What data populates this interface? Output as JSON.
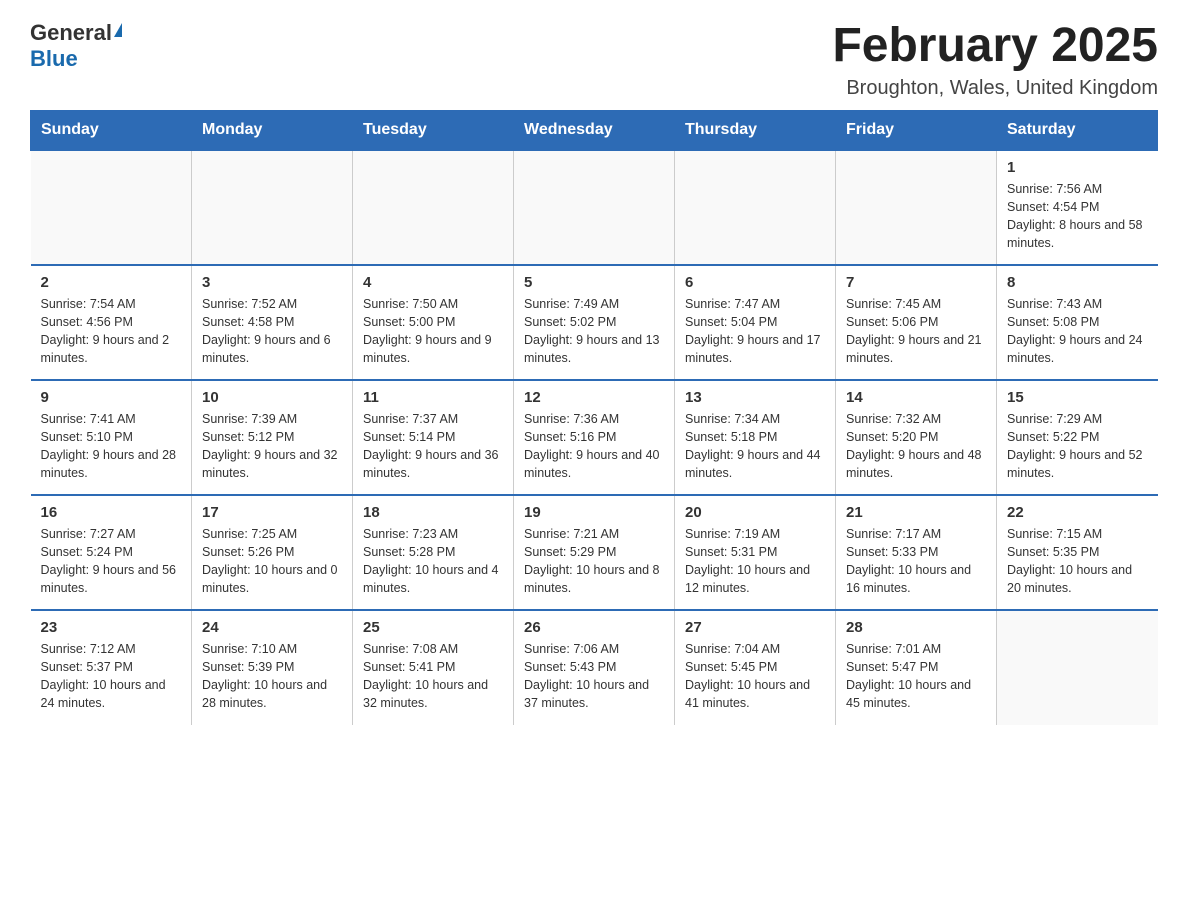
{
  "logo": {
    "general": "General",
    "blue": "Blue"
  },
  "title": "February 2025",
  "location": "Broughton, Wales, United Kingdom",
  "weekdays": [
    "Sunday",
    "Monday",
    "Tuesday",
    "Wednesday",
    "Thursday",
    "Friday",
    "Saturday"
  ],
  "weeks": [
    [
      {
        "day": "",
        "info": ""
      },
      {
        "day": "",
        "info": ""
      },
      {
        "day": "",
        "info": ""
      },
      {
        "day": "",
        "info": ""
      },
      {
        "day": "",
        "info": ""
      },
      {
        "day": "",
        "info": ""
      },
      {
        "day": "1",
        "info": "Sunrise: 7:56 AM\nSunset: 4:54 PM\nDaylight: 8 hours and 58 minutes."
      }
    ],
    [
      {
        "day": "2",
        "info": "Sunrise: 7:54 AM\nSunset: 4:56 PM\nDaylight: 9 hours and 2 minutes."
      },
      {
        "day": "3",
        "info": "Sunrise: 7:52 AM\nSunset: 4:58 PM\nDaylight: 9 hours and 6 minutes."
      },
      {
        "day": "4",
        "info": "Sunrise: 7:50 AM\nSunset: 5:00 PM\nDaylight: 9 hours and 9 minutes."
      },
      {
        "day": "5",
        "info": "Sunrise: 7:49 AM\nSunset: 5:02 PM\nDaylight: 9 hours and 13 minutes."
      },
      {
        "day": "6",
        "info": "Sunrise: 7:47 AM\nSunset: 5:04 PM\nDaylight: 9 hours and 17 minutes."
      },
      {
        "day": "7",
        "info": "Sunrise: 7:45 AM\nSunset: 5:06 PM\nDaylight: 9 hours and 21 minutes."
      },
      {
        "day": "8",
        "info": "Sunrise: 7:43 AM\nSunset: 5:08 PM\nDaylight: 9 hours and 24 minutes."
      }
    ],
    [
      {
        "day": "9",
        "info": "Sunrise: 7:41 AM\nSunset: 5:10 PM\nDaylight: 9 hours and 28 minutes."
      },
      {
        "day": "10",
        "info": "Sunrise: 7:39 AM\nSunset: 5:12 PM\nDaylight: 9 hours and 32 minutes."
      },
      {
        "day": "11",
        "info": "Sunrise: 7:37 AM\nSunset: 5:14 PM\nDaylight: 9 hours and 36 minutes."
      },
      {
        "day": "12",
        "info": "Sunrise: 7:36 AM\nSunset: 5:16 PM\nDaylight: 9 hours and 40 minutes."
      },
      {
        "day": "13",
        "info": "Sunrise: 7:34 AM\nSunset: 5:18 PM\nDaylight: 9 hours and 44 minutes."
      },
      {
        "day": "14",
        "info": "Sunrise: 7:32 AM\nSunset: 5:20 PM\nDaylight: 9 hours and 48 minutes."
      },
      {
        "day": "15",
        "info": "Sunrise: 7:29 AM\nSunset: 5:22 PM\nDaylight: 9 hours and 52 minutes."
      }
    ],
    [
      {
        "day": "16",
        "info": "Sunrise: 7:27 AM\nSunset: 5:24 PM\nDaylight: 9 hours and 56 minutes."
      },
      {
        "day": "17",
        "info": "Sunrise: 7:25 AM\nSunset: 5:26 PM\nDaylight: 10 hours and 0 minutes."
      },
      {
        "day": "18",
        "info": "Sunrise: 7:23 AM\nSunset: 5:28 PM\nDaylight: 10 hours and 4 minutes."
      },
      {
        "day": "19",
        "info": "Sunrise: 7:21 AM\nSunset: 5:29 PM\nDaylight: 10 hours and 8 minutes."
      },
      {
        "day": "20",
        "info": "Sunrise: 7:19 AM\nSunset: 5:31 PM\nDaylight: 10 hours and 12 minutes."
      },
      {
        "day": "21",
        "info": "Sunrise: 7:17 AM\nSunset: 5:33 PM\nDaylight: 10 hours and 16 minutes."
      },
      {
        "day": "22",
        "info": "Sunrise: 7:15 AM\nSunset: 5:35 PM\nDaylight: 10 hours and 20 minutes."
      }
    ],
    [
      {
        "day": "23",
        "info": "Sunrise: 7:12 AM\nSunset: 5:37 PM\nDaylight: 10 hours and 24 minutes."
      },
      {
        "day": "24",
        "info": "Sunrise: 7:10 AM\nSunset: 5:39 PM\nDaylight: 10 hours and 28 minutes."
      },
      {
        "day": "25",
        "info": "Sunrise: 7:08 AM\nSunset: 5:41 PM\nDaylight: 10 hours and 32 minutes."
      },
      {
        "day": "26",
        "info": "Sunrise: 7:06 AM\nSunset: 5:43 PM\nDaylight: 10 hours and 37 minutes."
      },
      {
        "day": "27",
        "info": "Sunrise: 7:04 AM\nSunset: 5:45 PM\nDaylight: 10 hours and 41 minutes."
      },
      {
        "day": "28",
        "info": "Sunrise: 7:01 AM\nSunset: 5:47 PM\nDaylight: 10 hours and 45 minutes."
      },
      {
        "day": "",
        "info": ""
      }
    ]
  ]
}
